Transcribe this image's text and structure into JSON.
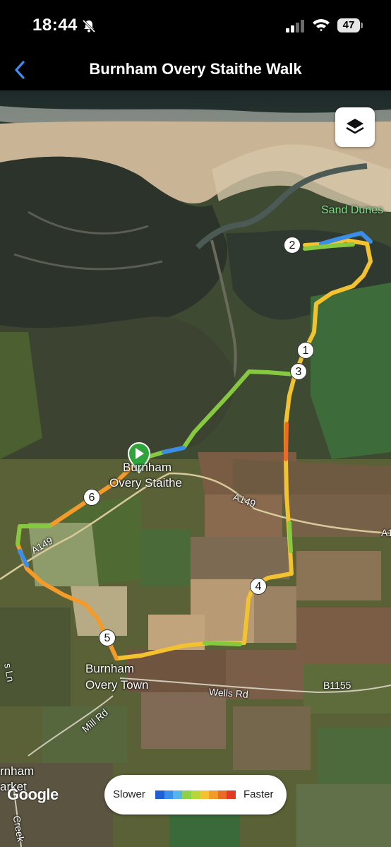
{
  "status_bar": {
    "time": "18:44",
    "battery": "47",
    "icons": [
      "bell-slash-icon",
      "cellular-signal-icon",
      "wifi-icon",
      "battery-icon"
    ]
  },
  "nav": {
    "title": "Burnham Overy Staithe Walk",
    "back_icon": "chevron-left-icon"
  },
  "map": {
    "layers_icon": "layers-icon",
    "attribution": "Google",
    "place_labels": {
      "sand_dunes": "Sand Dunes",
      "staithe_line1": "Burnham",
      "staithe_line2": "Overy Staithe",
      "town_line1": "Burnham",
      "town_line2": "Overy Town",
      "market_line1": "rnham",
      "market_line2": "arket"
    },
    "road_labels": {
      "a149_east": "A149",
      "a149_east_edge": "A1",
      "a149_west": "A149",
      "wells_rd": "Wells Rd",
      "b1155": "B1155",
      "mill_rd": "Mill Rd",
      "creek": "Creek",
      "lane": "s Ln"
    },
    "markers": [
      "1",
      "2",
      "3",
      "4",
      "5",
      "6"
    ],
    "start_marker_icon": "play-icon"
  },
  "legend": {
    "slower": "Slower",
    "faster": "Faster",
    "colors": [
      "#1f5fd6",
      "#3a8ee8",
      "#55b4e8",
      "#8ed04a",
      "#b7d63a",
      "#f2c230",
      "#f29a2a",
      "#ec6a28",
      "#e03a24"
    ]
  }
}
